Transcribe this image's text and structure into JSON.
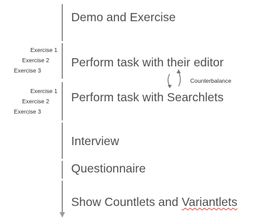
{
  "steps": [
    {
      "label": "Demo and Exercise"
    },
    {
      "label": "Perform task with their editor"
    },
    {
      "label": "Perform task with Searchlets"
    },
    {
      "label": "Interview"
    },
    {
      "label": "Questionnaire"
    },
    {
      "label_a": "Show Countlets and ",
      "label_b": "Variantlets"
    }
  ],
  "exercises_editor": [
    "Exercise 1",
    "Exercise 2",
    "Exercise 3"
  ],
  "exercises_searchlets": [
    "Exercise 1",
    "Exercise 2",
    "Exercise 3"
  ],
  "counterbalance_label": "Counterbalance"
}
